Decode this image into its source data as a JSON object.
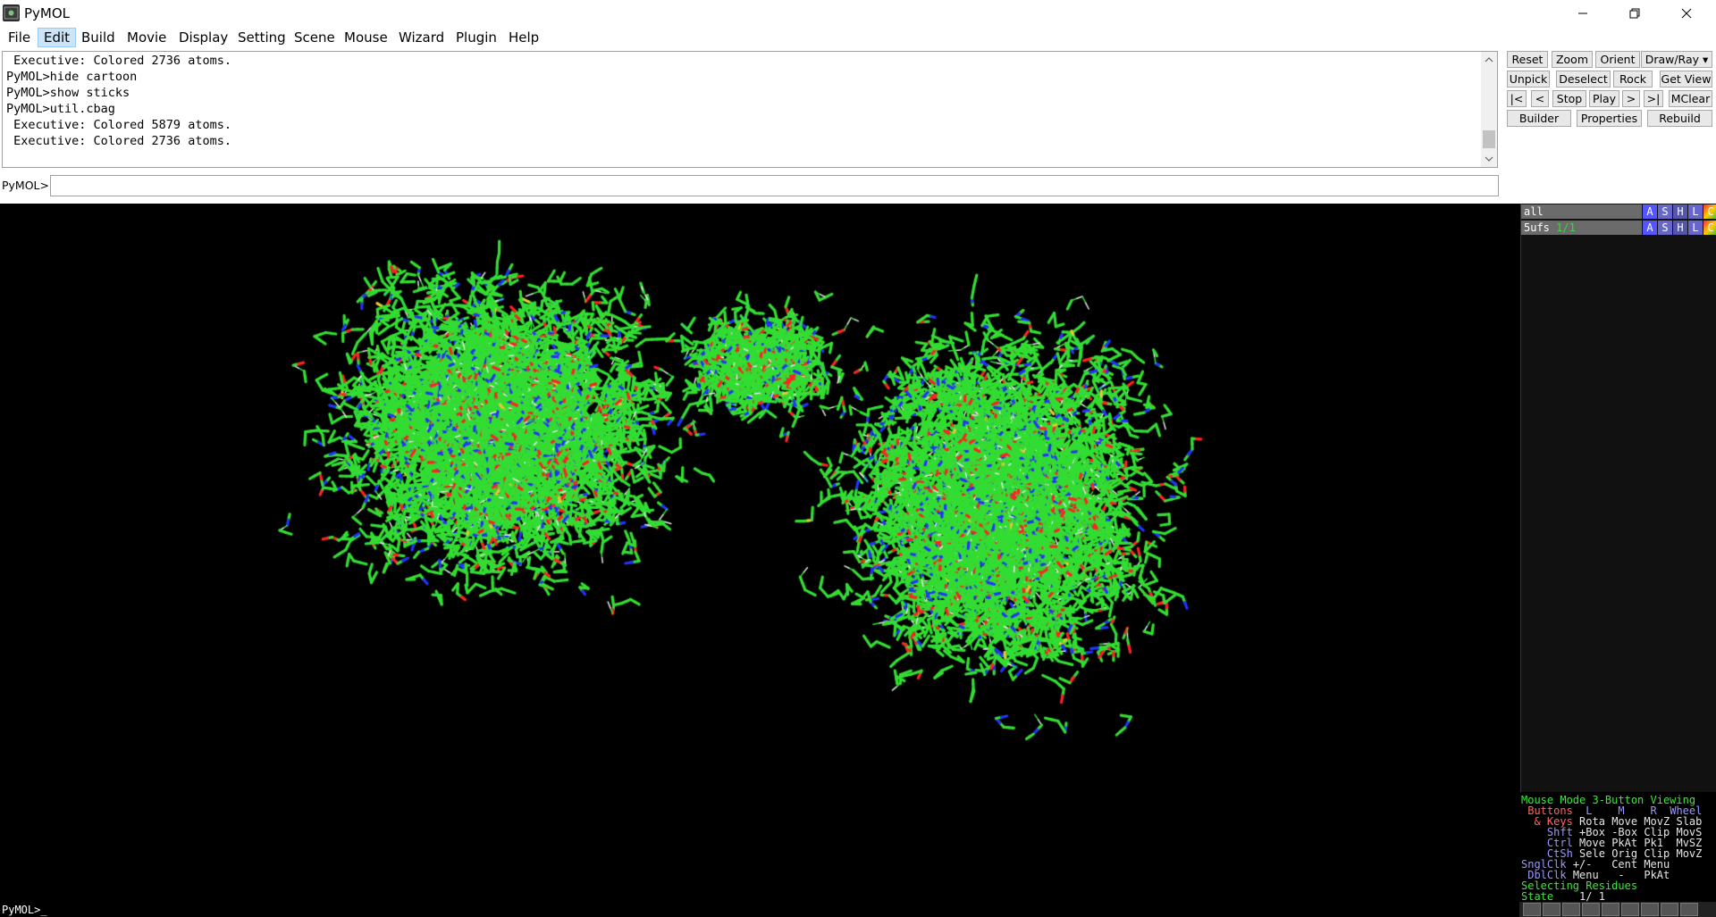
{
  "window": {
    "title": "PyMOL",
    "icon": "pymol-app-icon"
  },
  "menu": [
    "File",
    "Edit",
    "Build",
    "Movie",
    "Display",
    "Setting",
    "Scene",
    "Mouse",
    "Wizard",
    "Plugin",
    "Help"
  ],
  "console": {
    "lines": [
      " Executive: Colored 2736 atoms.",
      "PyMOL>hide cartoon",
      "PyMOL>show sticks",
      "PyMOL>util.cbag",
      " Executive: Colored 5879 atoms.",
      " Executive: Colored 2736 atoms."
    ]
  },
  "command": {
    "label": "PyMOL>",
    "value": ""
  },
  "buttons": {
    "row1": [
      "Reset",
      "Zoom",
      "Orient",
      "Draw/Ray ▾"
    ],
    "row2": [
      "Unpick",
      "Deselect",
      "Rock",
      "Get View"
    ],
    "row3": [
      "|<",
      "<",
      "Stop",
      "Play",
      ">",
      ">|",
      "MClear"
    ],
    "row4": [
      "Builder",
      "Properties",
      "Rebuild"
    ]
  },
  "objects": [
    {
      "name": "all",
      "state": ""
    },
    {
      "name": "5ufs",
      "state": "1/1"
    }
  ],
  "object_buttons": [
    "A",
    "S",
    "H",
    "L",
    "C"
  ],
  "mouse_mode": {
    "title": "Mouse Mode",
    "mode": "3-Button Viewing",
    "header": [
      "Buttons",
      "L",
      "M",
      "R",
      "Wheel"
    ],
    "rows": [
      {
        "key": "& Keys",
        "vals": [
          "Rota",
          "Move",
          "MovZ",
          "Slab"
        ]
      },
      {
        "key": "Shft",
        "vals": [
          "+Box",
          "-Box",
          "Clip",
          "MovS"
        ]
      },
      {
        "key": "Ctrl",
        "vals": [
          "Move",
          "PkAt",
          "Pk1",
          "MvSZ"
        ]
      },
      {
        "key": "CtSh",
        "vals": [
          "Sele",
          "Orig",
          "Clip",
          "MovZ"
        ]
      },
      {
        "key": "SnglClk",
        "vals": [
          "+/-",
          "Cent",
          "Menu",
          ""
        ]
      },
      {
        "key": "DblClk",
        "vals": [
          "Menu",
          "-",
          "PkAt",
          ""
        ]
      }
    ],
    "selecting": "Selecting Residues",
    "state_label": "State",
    "state_value": "1/ 1"
  },
  "status": {
    "prompt": "PyMOL>_"
  },
  "colors": {
    "carbon": "#33dd33",
    "nitrogen": "#2233ff",
    "oxygen": "#ff2222",
    "hydrogen": "#e6e6e6",
    "sulfur": "#e6c832"
  }
}
